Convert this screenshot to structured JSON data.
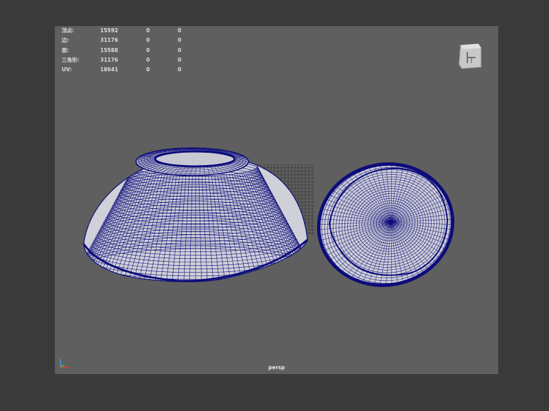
{
  "hud": {
    "rows": [
      {
        "label": "顶点:",
        "v1": "15592",
        "v2": "0",
        "v3": "0"
      },
      {
        "label": "边:",
        "v1": "31176",
        "v2": "0",
        "v3": "0"
      },
      {
        "label": "面:",
        "v1": "15588",
        "v2": "0",
        "v3": "0"
      },
      {
        "label": "三角形:",
        "v1": "31176",
        "v2": "0",
        "v3": "0"
      },
      {
        "label": "UV:",
        "v1": "18641",
        "v2": "0",
        "v3": "0"
      }
    ]
  },
  "camera": {
    "name": "persp"
  },
  "colors": {
    "viewport_bg": "#5f5f5f",
    "frame_bg": "#3a3a3a",
    "mesh_fill": "#d0d0d8",
    "wire": "#0c0c7a",
    "grid": "#2c2c2c",
    "hud_text": "#dcdcdc"
  },
  "icons": {
    "view_cube": "view-cube-icon",
    "axis": "axis-gizmo-icon"
  }
}
